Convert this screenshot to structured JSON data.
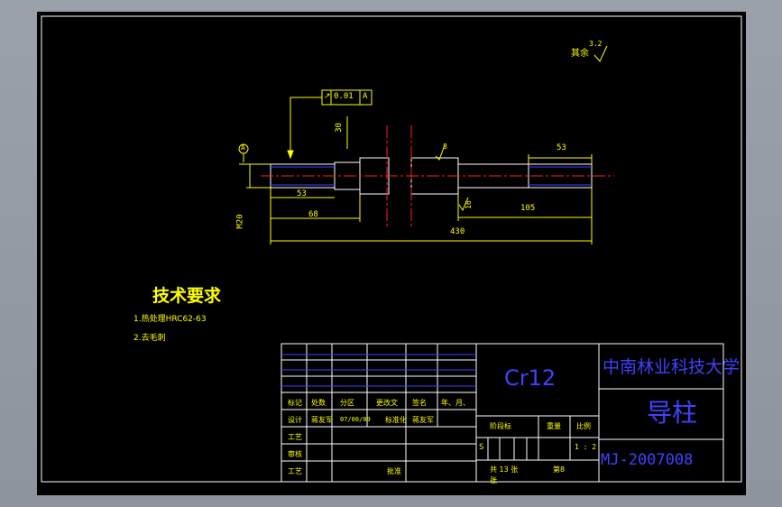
{
  "drawing": {
    "roughness_note": "其余",
    "roughness_value": "3.2",
    "runout_callout": {
      "symbol": "↗",
      "value": "0.01",
      "datum": "A"
    },
    "datum_label": "A",
    "dims": {
      "d30": "30",
      "d53_left": "53",
      "d68": "68",
      "d430": "430",
      "d53_right": "53",
      "d105": "105",
      "d16": "16",
      "d8": "8",
      "m20": "M20"
    }
  },
  "tech_requirements": {
    "title": "技术要求",
    "items": [
      "1.热处理HRC62-63",
      "2.去毛刺"
    ]
  },
  "title_block": {
    "material": "Cr12",
    "university": "中南林业科技大学",
    "part_name": "导柱",
    "drawing_no": "MJ-2007008",
    "rows": {
      "header": [
        "标记",
        "处数",
        "分区",
        "更改文",
        "签名",
        "年、月、"
      ],
      "design": "设计",
      "designer": "蒋友军",
      "date": "07/06/09",
      "standardize": "标准化",
      "designer2": "蒋友军",
      "craft1": "工艺",
      "review": "审核",
      "craft2": "工艺",
      "approve": "批准"
    },
    "stage_label": "阶段标",
    "weight_label": "重量",
    "scale_label": "比例",
    "stage_value": "S",
    "scale_value": "1 : 2",
    "sheet_total": "共 13 张",
    "sheet_no": "第8",
    "sheet_extra": "张"
  },
  "colors": {
    "background_gray": "#9aa1aa",
    "canvas": "#000000",
    "lines": "#ffffff",
    "annotation": "#ffff00",
    "centerline": "#ff2020",
    "title_block": "#4040ff"
  }
}
